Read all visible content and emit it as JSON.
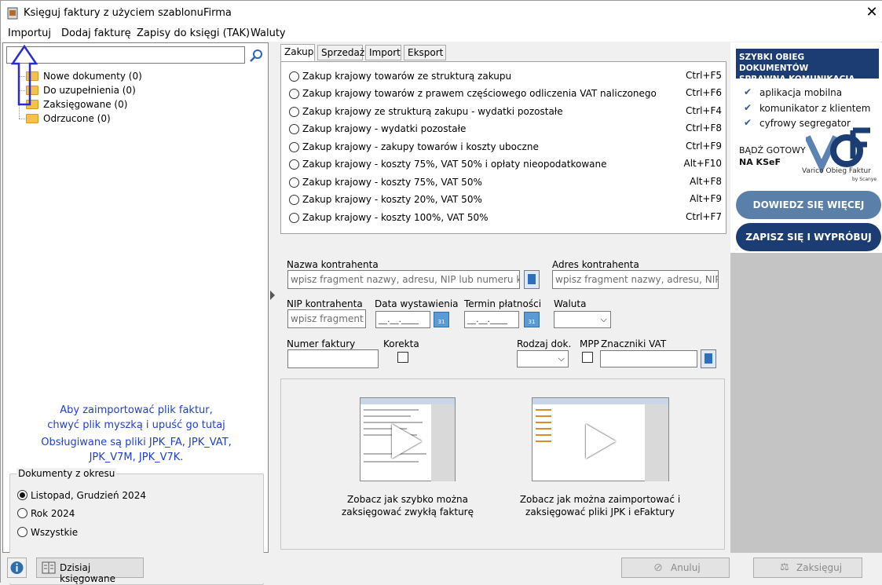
{
  "window": {
    "title": "Księguj faktury z użyciem szablonu.",
    "title2": "Firma",
    "close": "✕"
  },
  "menu": [
    "Importuj",
    "Dodaj fakturę",
    "Zapisy do księgi (TAK)",
    "Waluty"
  ],
  "left": {
    "search_value": "",
    "tree": [
      {
        "label": "Nowe dokumenty (0)"
      },
      {
        "label": "Do uzupełnienia (0)"
      },
      {
        "label": "Zaksięgowane (0)"
      },
      {
        "label": "Odrzucone (0)"
      }
    ],
    "drop_hint_1": "Aby zaimportować plik faktur,",
    "drop_hint_2": "chwyć plik myszką i upuść go tutaj",
    "drop_hint_3": "Obsługiwane są pliki JPK_FA, JPK_VAT,",
    "drop_hint_4": "JPK_V7M, JPK_V7K.",
    "period": {
      "legend": "Dokumenty z okresu",
      "options": [
        "Listopad, Grudzień 2024",
        "Rok 2024",
        "Wszystkie"
      ],
      "selected": 0
    }
  },
  "tabs": [
    "Zakup",
    "Sprzedaż",
    "Import",
    "Eksport"
  ],
  "active_tab": 0,
  "templates": [
    {
      "label": "Zakup krajowy towarów ze strukturą zakupu",
      "key": "Ctrl+F5"
    },
    {
      "label": "Zakup krajowy towarów z prawem częściowego odliczenia VAT naliczonego",
      "key": "Ctrl+F6"
    },
    {
      "label": "Zakup krajowy ze strukturą zakupu - wydatki pozostałe",
      "key": "Ctrl+F4"
    },
    {
      "label": "Zakup krajowy - wydatki pozostałe",
      "key": "Ctrl+F8"
    },
    {
      "label": "Zakup krajowy - zakupy towarów i koszty uboczne",
      "key": "Ctrl+F9"
    },
    {
      "label": "Zakup krajowy - koszty 75%, VAT 50% i opłaty nieopodatkowane",
      "key": "Alt+F10"
    },
    {
      "label": "Zakup krajowy - koszty 75%, VAT 50%",
      "key": "Alt+F8"
    },
    {
      "label": "Zakup krajowy - koszty 20%, VAT 50%",
      "key": "Alt+F9"
    },
    {
      "label": "Zakup krajowy - koszty 100%, VAT 50%",
      "key": "Ctrl+F7"
    }
  ],
  "form": {
    "contractor_name_label": "Nazwa kontrahenta",
    "contractor_name_placeholder": "wpisz fragment nazwy, adresu, NIP lub numeru konta",
    "contractor_address_label": "Adres kontrahenta",
    "contractor_address_placeholder": "wpisz fragment nazwy, adresu, NIP lub",
    "nip_label": "NIP kontrahenta",
    "nip_placeholder": "wpisz fragment n",
    "issue_date_label": "Data wystawienia",
    "issue_date_value": "__.__.____",
    "due_date_label": "Termin płatności",
    "due_date_value": "__.__.____",
    "currency_label": "Waluta",
    "invoice_no_label": "Numer faktury",
    "correction_label": "Korekta",
    "doc_type_label": "Rodzaj dok.",
    "mpp_label": "MPP",
    "vat_markers_label": "Znaczniki VAT",
    "cal_icon_text": "31"
  },
  "videos": [
    {
      "caption_1": "Zobacz jak szybko można",
      "caption_2": "zaksięgować zwykłą fakturę"
    },
    {
      "caption_1": "Zobacz jak można zaimportować i",
      "caption_2": "zaksięgować pliki JPK i eFaktury"
    }
  ],
  "ad": {
    "header_1": "SZYBKI OBIEG DOKUMENTÓW",
    "header_2": "SPRAWNA KOMUNIKACJA",
    "features": [
      "aplikacja mobilna",
      "komunikator z klientem",
      "cyfrowy segregator"
    ],
    "ready_1": "BĄDŹ GOTOWY",
    "ready_2": "NA KSeF",
    "brand": "Varico Obieg Faktur",
    "brand_sub": "by Scanye",
    "btn_more": "DOWIEDZ SIĘ WIĘCEJ",
    "btn_signup": "ZAPISZ SIĘ I WYPRÓBUJ",
    "color_dark": "#1b3d73",
    "color_light": "#5a7fa8"
  },
  "bottom": {
    "today_posted": "Dzisiaj księgowane",
    "cancel": "Anuluj",
    "post": "Zaksięguj"
  }
}
